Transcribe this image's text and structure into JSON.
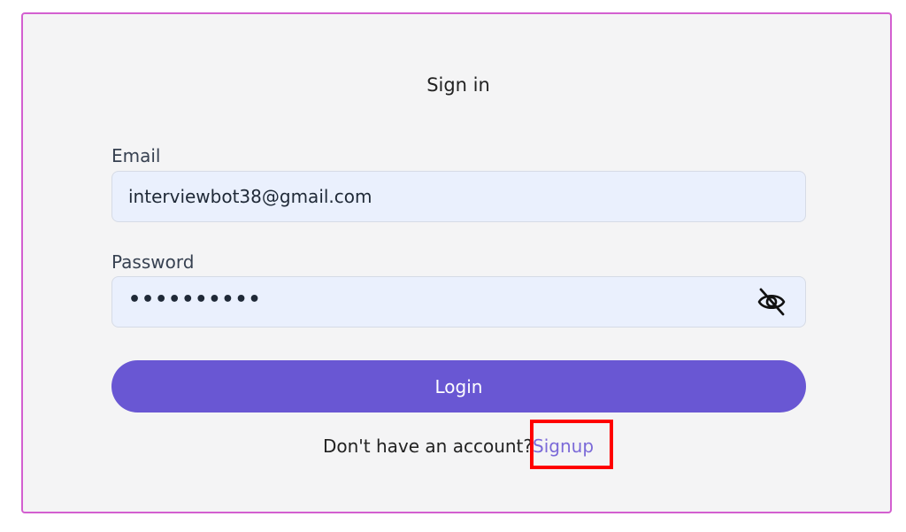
{
  "form": {
    "title": "Sign in",
    "email": {
      "label": "Email",
      "value": "interviewbot38@gmail.com"
    },
    "password": {
      "label": "Password",
      "masked_value": "••••••••••",
      "toggle_icon": "eye-slash-icon"
    },
    "login_label": "Login",
    "signup_prompt": "Don't have an account?",
    "signup_link": "Signup"
  },
  "colors": {
    "card_border": "#d35fd0",
    "card_background": "#f4f4f5",
    "input_background": "#eaf0fd",
    "primary_button": "#6957d3",
    "link": "#7b6ad8",
    "highlight_box": "#ff0000"
  }
}
